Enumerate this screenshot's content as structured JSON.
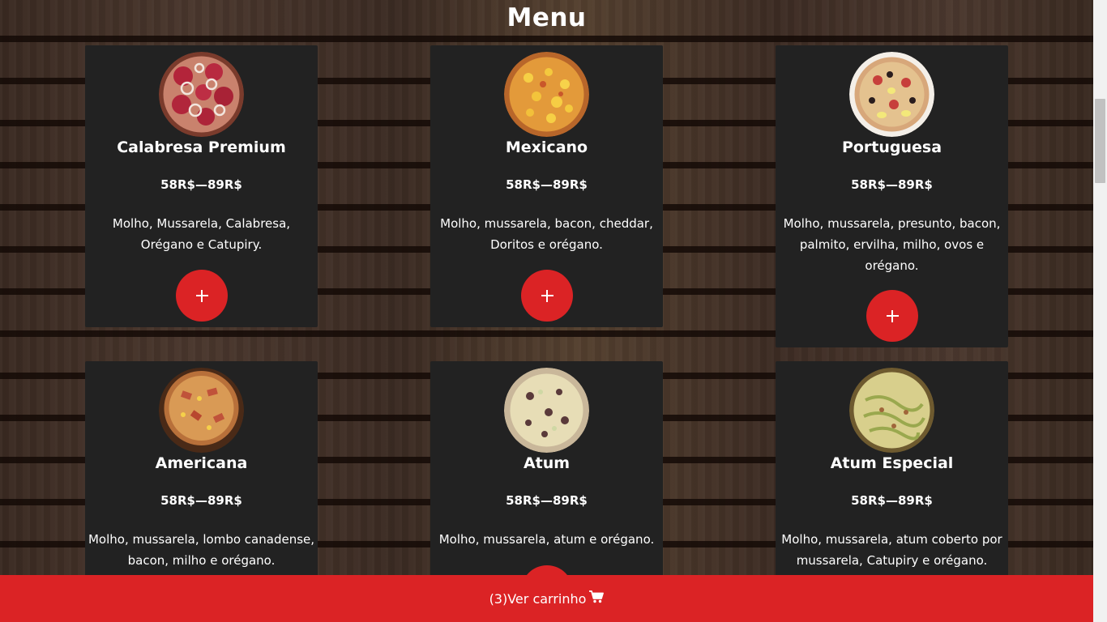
{
  "page": {
    "title": "Menu"
  },
  "colors": {
    "accent": "#db2325",
    "card": "#222222",
    "text": "#ffffff"
  },
  "products": [
    {
      "name": "Calabresa Premium",
      "price": "58R$—89R$",
      "description": "Molho, Mussarela, Calabresa, Orégano e Catupiry.",
      "image_icon": "pizza-calabresa-image",
      "add_label": "+"
    },
    {
      "name": "Mexicano",
      "price": "58R$—89R$",
      "description": "Molho, mussarela, bacon, cheddar, Doritos e orégano.",
      "image_icon": "pizza-mexicano-image",
      "add_label": "+"
    },
    {
      "name": "Portuguesa",
      "price": "58R$—89R$",
      "description": "Molho, mussarela, presunto, bacon, palmito, ervilha, milho, ovos e orégano.",
      "image_icon": "pizza-portuguesa-image",
      "add_label": "+"
    },
    {
      "name": "Americana",
      "price": "58R$—89R$",
      "description": "Molho, mussarela, lombo canadense, bacon, milho e orégano.",
      "image_icon": "pizza-americana-image",
      "add_label": "+"
    },
    {
      "name": "Atum",
      "price": "58R$—89R$",
      "description": "Molho, mussarela, atum e orégano.",
      "image_icon": "pizza-atum-image",
      "add_label": "+"
    },
    {
      "name": "Atum Especial",
      "price": "58R$—89R$",
      "description": "Molho, mussarela, atum coberto por mussarela, Catupiry e orégano.",
      "image_icon": "pizza-atum-especial-image",
      "add_label": "+"
    }
  ],
  "cart": {
    "label": "(3)Ver carrinho",
    "count": 3,
    "icon": "shopping-cart-icon"
  }
}
